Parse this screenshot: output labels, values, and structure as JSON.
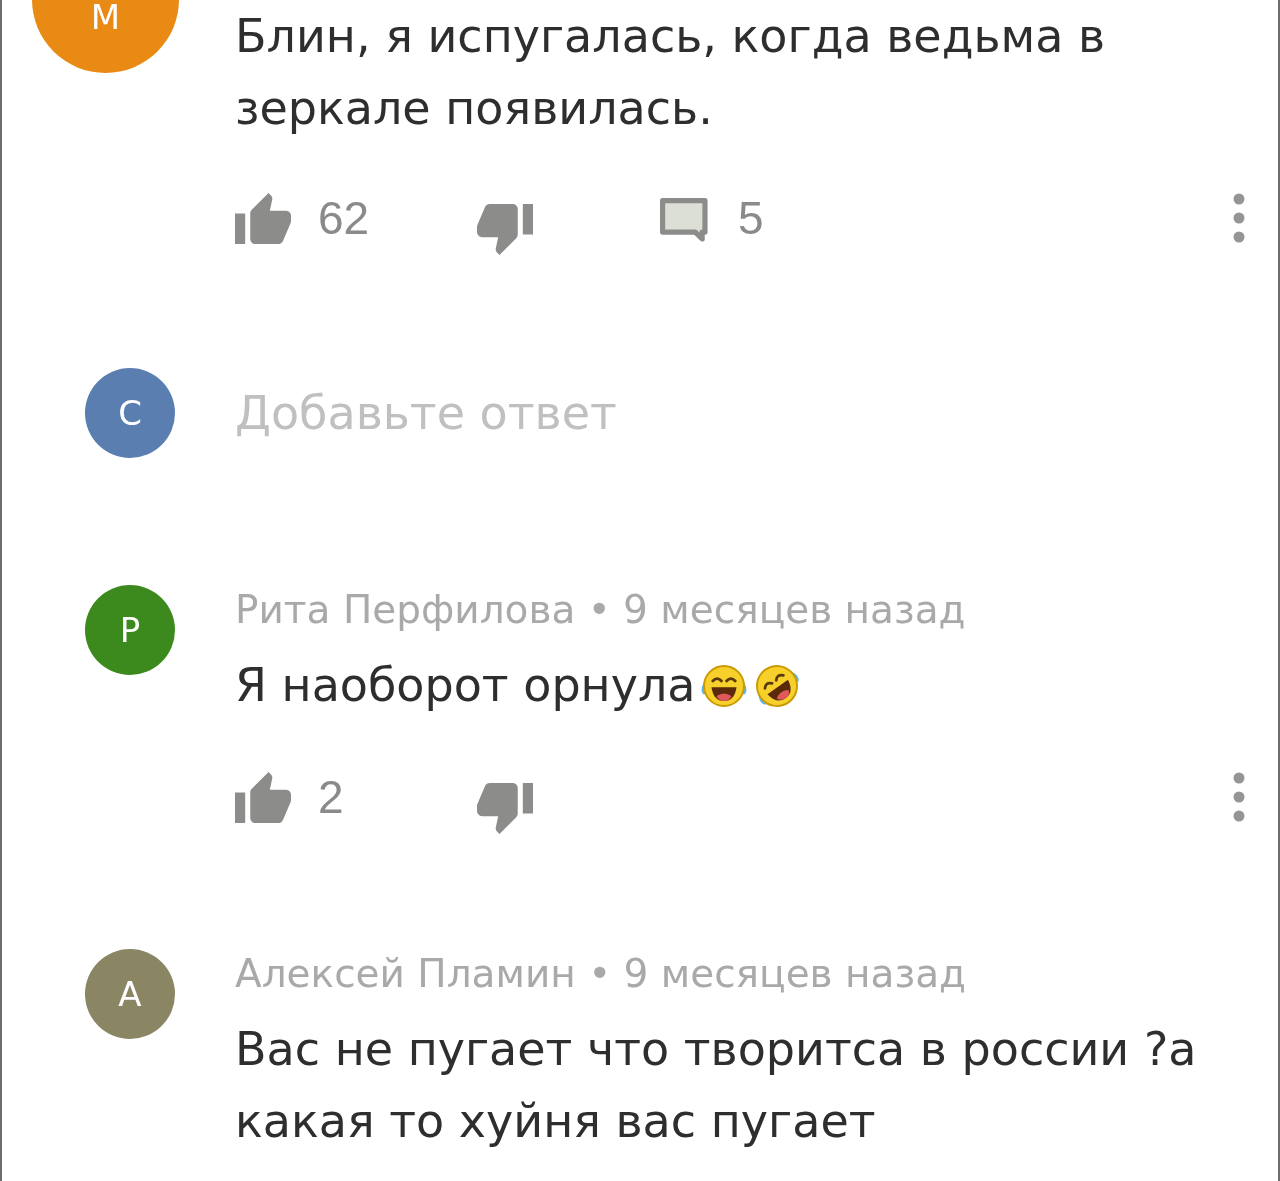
{
  "comment": {
    "avatar": {
      "initial": "М",
      "color": "#e88a14"
    },
    "text": "Блин, я испугалась, когда ведьма в зеркале появилась.",
    "actions": {
      "likes": "62",
      "replies": "5"
    }
  },
  "reply_box": {
    "avatar": {
      "initial": "С",
      "color": "#5b7eb1"
    },
    "placeholder": "Добавьте ответ"
  },
  "replies": [
    {
      "avatar": {
        "initial": "Р",
        "color": "#3c8a1d"
      },
      "byline": "Рита Перфилова • 9 месяцев назад",
      "text": "Я наоборот орнула",
      "emoji": [
        {
          "kind": "laughing"
        },
        {
          "kind": "rolling"
        }
      ],
      "actions": {
        "likes": "2"
      }
    },
    {
      "avatar": {
        "initial": "А",
        "color": "#8a8563"
      },
      "byline": "Алексей Пламин • 9 месяцев назад",
      "text": "Вас не пугает что творитса в россии ?а какая то хуйня вас пугает"
    }
  ]
}
